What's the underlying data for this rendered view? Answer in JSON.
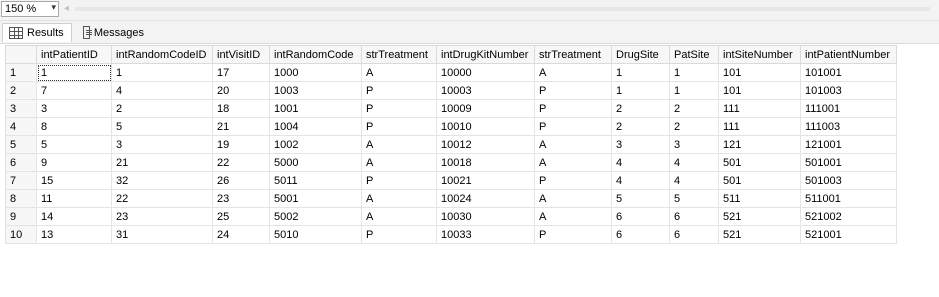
{
  "toolbar": {
    "zoom_value": "150 %"
  },
  "tabs": [
    {
      "label": "Results",
      "icon": "grid-icon",
      "active": true
    },
    {
      "label": "Messages",
      "icon": "messages-icon",
      "active": false
    }
  ],
  "table": {
    "columns": [
      "",
      "intPatientID",
      "intRandomCodeID",
      "intVisitID",
      "intRandomCode",
      "strTreatment",
      "intDrugKitNumber",
      "strTreatment",
      "DrugSite",
      "PatSite",
      "intSiteNumber",
      "intPatientNumber"
    ],
    "rows": [
      [
        "1",
        "1",
        "1",
        "17",
        "1000",
        "A",
        "10000",
        "A",
        "1",
        "1",
        "101",
        "101001"
      ],
      [
        "2",
        "7",
        "4",
        "20",
        "1003",
        "P",
        "10003",
        "P",
        "1",
        "1",
        "101",
        "101003"
      ],
      [
        "3",
        "3",
        "2",
        "18",
        "1001",
        "P",
        "10009",
        "P",
        "2",
        "2",
        "111",
        "111001"
      ],
      [
        "4",
        "8",
        "5",
        "21",
        "1004",
        "P",
        "10010",
        "P",
        "2",
        "2",
        "111",
        "111003"
      ],
      [
        "5",
        "5",
        "3",
        "19",
        "1002",
        "A",
        "10012",
        "A",
        "3",
        "3",
        "121",
        "121001"
      ],
      [
        "6",
        "9",
        "21",
        "22",
        "5000",
        "A",
        "10018",
        "A",
        "4",
        "4",
        "501",
        "501001"
      ],
      [
        "7",
        "15",
        "32",
        "26",
        "5011",
        "P",
        "10021",
        "P",
        "4",
        "4",
        "501",
        "501003"
      ],
      [
        "8",
        "11",
        "22",
        "23",
        "5001",
        "A",
        "10024",
        "A",
        "5",
        "5",
        "511",
        "511001"
      ],
      [
        "9",
        "14",
        "23",
        "25",
        "5002",
        "A",
        "10030",
        "A",
        "6",
        "6",
        "521",
        "521002"
      ],
      [
        "10",
        "13",
        "31",
        "24",
        "5010",
        "P",
        "10033",
        "P",
        "6",
        "6",
        "521",
        "521001"
      ]
    ]
  }
}
